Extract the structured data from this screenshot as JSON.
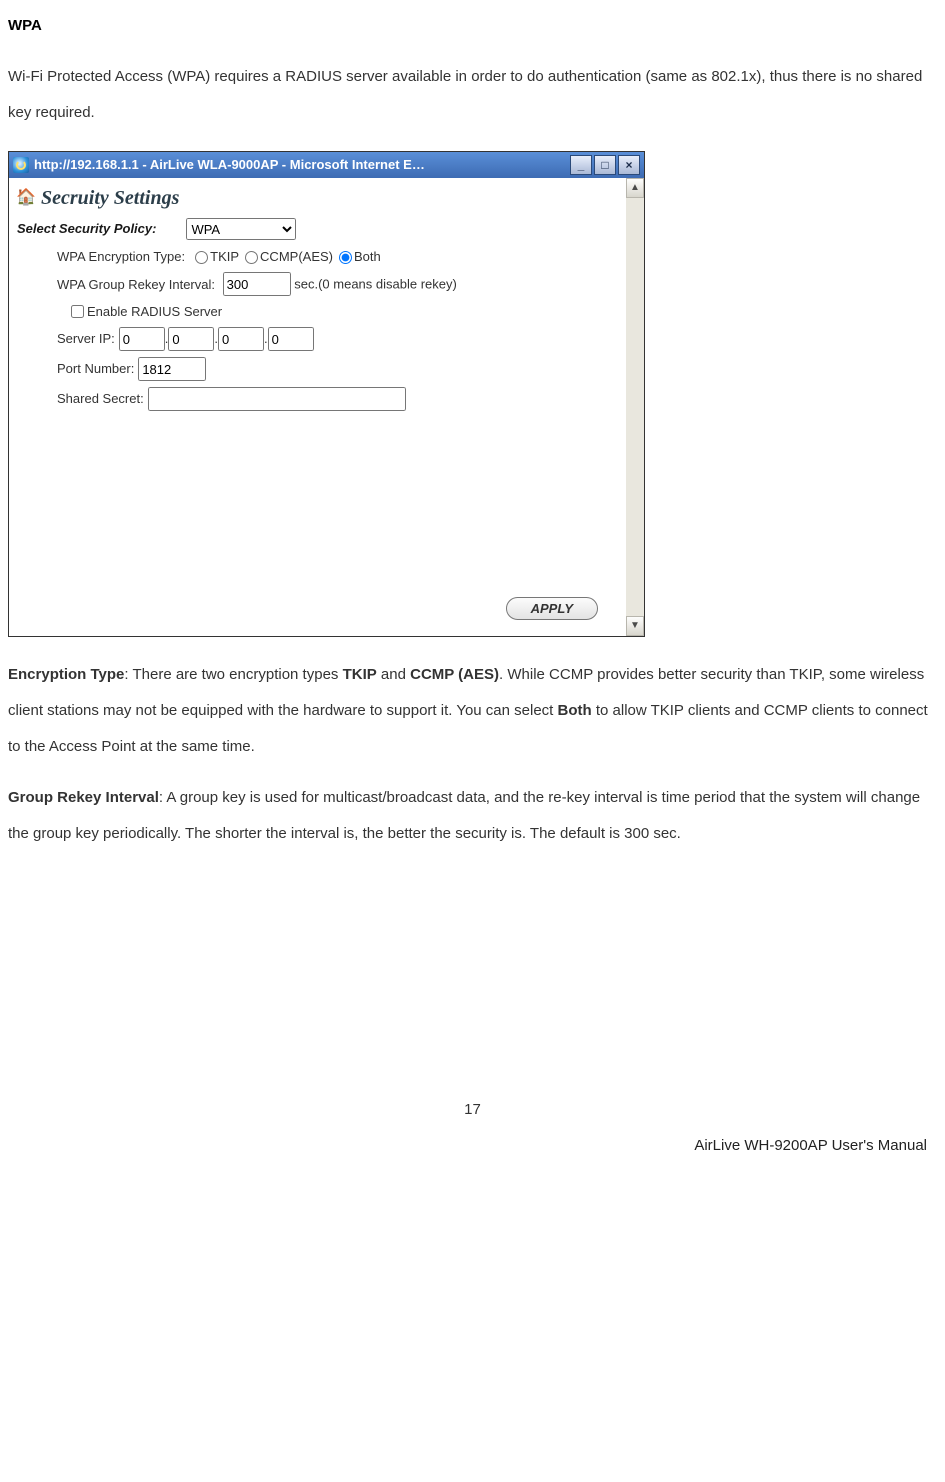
{
  "heading": "WPA",
  "intro": "Wi-Fi Protected Access (WPA) requires a RADIUS server available in order to do authentication (same as 802.1x), thus there is no shared key required.",
  "window": {
    "title": "http://192.168.1.1 - AirLive WLA-9000AP - Microsoft Internet E…",
    "min": "_",
    "max": "□",
    "close": "×",
    "scroll_up": "▲",
    "scroll_down": "▼"
  },
  "form": {
    "section_title": "Secruity Settings",
    "select_label": "Select Security Policy:",
    "select_value": "WPA",
    "enc_label": "WPA Encryption Type:",
    "tkip": "TKIP",
    "ccmp": "CCMP(AES)",
    "both": "Both",
    "enc_selected": "both",
    "rekey_label": "WPA Group Rekey Interval:",
    "rekey_value": "300",
    "rekey_suffix": "sec.(0 means disable rekey)",
    "enable_radius": "Enable RADIUS Server",
    "server_ip_label": "Server IP:",
    "ip1": "0",
    "ip2": "0",
    "ip3": "0",
    "ip4": "0",
    "port_label": "Port Number:",
    "port_value": "1812",
    "secret_label": "Shared Secret:",
    "secret_value": "",
    "apply": "APPLY"
  },
  "enc_para_label": "Encryption Type",
  "enc_para1": ": There are two encryption types ",
  "tkip_bold": "TKIP",
  "and_txt": " and ",
  "ccmp_bold": "CCMP (AES)",
  "enc_para2": ". While CCMP provides better security than TKIP, some wireless client stations may not be equipped with the hardware to support it. You can select ",
  "both_bold": "Both",
  "enc_para3": " to allow TKIP clients and CCMP clients to connect to the Access Point at the same time.",
  "gri_label": "Group Rekey Interval",
  "gri_text": ": A group key is used for multicast/broadcast data, and the re-key interval is time period that the system will change the group key periodically. The shorter the interval is, the better the security is. The default is 300 sec.",
  "page_num": "17",
  "footer_right": "AirLive WH-9200AP User's Manual"
}
